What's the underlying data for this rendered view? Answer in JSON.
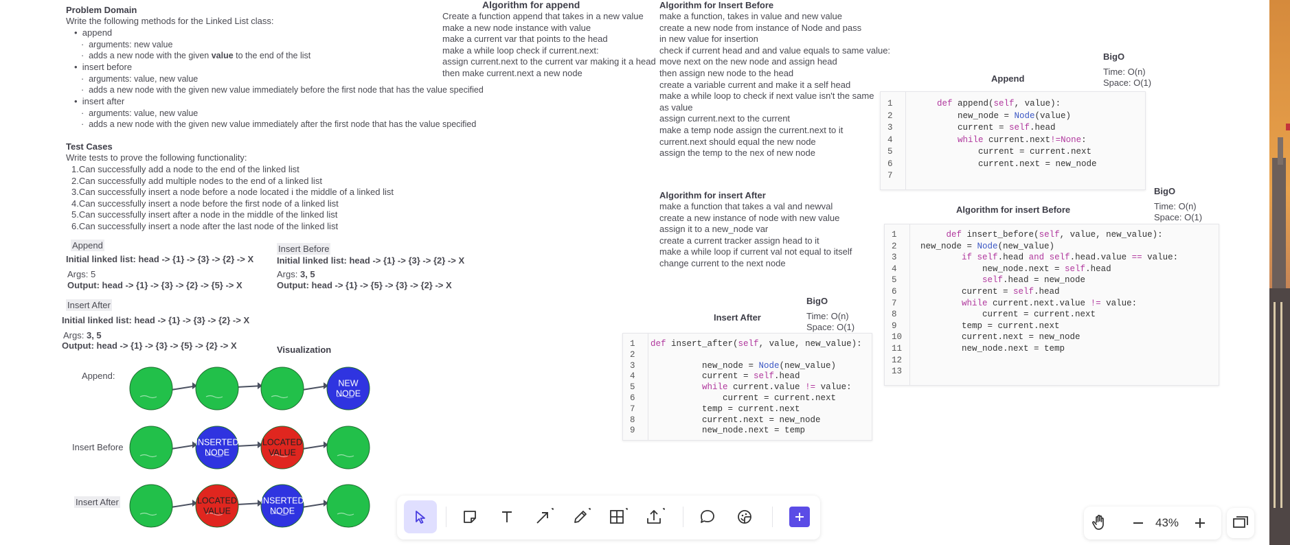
{
  "problem_domain": {
    "title": "Problem Domain",
    "intro": "Write the following methods for the Linked List class:",
    "methods": [
      {
        "name": "append",
        "args": "arguments: new value",
        "desc_pre": "adds a new node with the given ",
        "desc_bold": "value",
        "desc_post": " to the end of the list"
      },
      {
        "name": "insert before",
        "args": "arguments: value, new value",
        "desc_pre": "adds a new node with the given new value immediately before the first node that has the value specified",
        "desc_bold": "",
        "desc_post": ""
      },
      {
        "name": "insert after",
        "args": "arguments: value, new value",
        "desc_pre": "adds a new node with the given new value immediately after the first node that has the value specified",
        "desc_bold": "",
        "desc_post": ""
      }
    ]
  },
  "test_cases": {
    "title": "Test Cases",
    "intro": "Write tests to prove the following functionality:",
    "items": [
      "Can successfully add a node to the end of the linked list",
      "Can successfully add multiple nodes to the end of a linked list",
      "Can successfully insert a node before a node located i the middle of a linked list",
      "Can successfully insert a node before the first node of a linked list",
      "Can successfully insert after a node in the middle of the linked list",
      "Can successfully insert a node after the last node of the linked list"
    ],
    "numbers": [
      "1.",
      "2.",
      "3.",
      "4.",
      "5.",
      "6."
    ]
  },
  "examples": {
    "append": {
      "tag": "Append",
      "initial_label": "Initial linked list:",
      "initial": "head -> {1} -> {3} -> {2} -> X",
      "args_label": "Args:",
      "args": "5",
      "output_label": "Output:",
      "output": "head -> {1} -> {3} -> {2} -> {5} -> X"
    },
    "insert_before": {
      "tag": "Insert Before",
      "initial_label": "Initial linked list:",
      "initial": "head -> {1} -> {3} -> {2} -> X",
      "args_label": "Args:",
      "args": "3, 5",
      "output_label": "Output:",
      "output": "head -> {1} -> {5} -> {3} -> {2} -> X"
    },
    "insert_after": {
      "tag": "Insert After",
      "initial_label": "Initial linked list:",
      "initial": "head -> {1} -> {3} -> {2} -> X",
      "args_label": "Args:",
      "args": "3, 5",
      "output_label": "Output:",
      "output": "head -> {1} -> {3} -> {5} -> {2} -> X"
    }
  },
  "visualization": {
    "title": "Visualization",
    "rows": [
      {
        "label": "Append:",
        "nodes": [
          {
            "color": "green",
            "text": ""
          },
          {
            "color": "green",
            "text": ""
          },
          {
            "color": "green",
            "text": ""
          },
          {
            "color": "blue",
            "text": "NEW NODE"
          }
        ]
      },
      {
        "label": "Insert Before",
        "nodes": [
          {
            "color": "green",
            "text": ""
          },
          {
            "color": "blue",
            "text": "INSERTED NODE"
          },
          {
            "color": "red",
            "text": "LOCATED VALUE"
          },
          {
            "color": "green",
            "text": ""
          }
        ]
      },
      {
        "label": "Insert After",
        "nodes": [
          {
            "color": "green",
            "text": ""
          },
          {
            "color": "red",
            "text": "LOCATED VALUE"
          },
          {
            "color": "blue",
            "text": "INSERTED NODE"
          },
          {
            "color": "green",
            "text": ""
          }
        ]
      }
    ],
    "colors": {
      "green": "#22c04a",
      "blue": "#2f34e0",
      "red": "#e0261f"
    }
  },
  "algo_append": {
    "title": "Algorithm for append",
    "lines": [
      "Create a function append that takes in a new value",
      "make a new node instance with value",
      "make a current var that points to the head",
      "make a while loop check if current.next:",
      "assign current.next to the current var making it a head",
      "then make current.next a new node"
    ]
  },
  "algo_insert_before": {
    "title": "Algorithm for Insert Before",
    "lines": [
      "make a function, takes in value and new value",
      "create a new node from instance of Node and pass",
      "in new value for insertion",
      "check if current head and and value equals to same value:",
      "move next on the new node and assign head",
      "then assign new node to the head",
      "create a variable current and make it a self head",
      "make a while loop to check if next value isn't the same",
      "as value",
      "assign current.next to the current",
      "make a temp node assign the current.next to it",
      "current.next should equal the new node",
      "assign the temp to the nex of new node"
    ]
  },
  "algo_insert_after": {
    "title": "Algorithm for insert After",
    "lines": [
      "make a function that takes a val and newval",
      "create a new instance of node with new value",
      "assign it to a new_node var",
      "create a current tracker assign head to it",
      "make a while loop if current val not equal to itself",
      "change current to the next node"
    ]
  },
  "bigo_append": {
    "title": "BigO",
    "time": "Time: O(n)",
    "space": "Space: O(1)"
  },
  "bigo_insert_before": {
    "title": "BigO",
    "time": "Time: O(n)",
    "space": "Space: O(1)"
  },
  "bigo_insert_after": {
    "title": "BigO",
    "time": "Time: O(n)",
    "space": "Space: O(1)"
  },
  "code_append": {
    "caption": "Append",
    "line_numbers": [
      "1",
      "2",
      "3",
      "4",
      "5",
      "6",
      "7"
    ],
    "lines": [
      "    def append(self, value):",
      "        new_node = Node(value)",
      "        current = self.head",
      "        while current.next!=None:",
      "            current = current.next",
      "            current.next = new_node",
      ""
    ]
  },
  "code_insert_before": {
    "caption": "Algorithm for insert Before",
    "line_numbers": [
      "1",
      "2",
      "3",
      "4",
      "5",
      "6",
      "7",
      "8",
      "9",
      "10",
      "11",
      "12",
      "13"
    ],
    "lines": [
      "     def insert_before(self, value, new_value):",
      "new_node = Node(new_value)",
      "        if self.head and self.head.value == value:",
      "            new_node.next = self.head",
      "            self.head = new_node",
      "        current = self.head",
      "        while current.next.value != value:",
      "            current = current.next",
      "        temp = current.next",
      "        current.next = new_node",
      "        new_node.next = temp",
      "",
      ""
    ]
  },
  "code_insert_after": {
    "caption": "Insert After",
    "line_numbers": [
      "1",
      "2",
      "3",
      "4",
      "5",
      "6",
      "7",
      "8",
      "9"
    ],
    "lines": [
      "def insert_after(self, value, new_value):",
      "",
      "          new_node = Node(new_value)",
      "          current = self.head",
      "          while current.value != value:",
      "              current = current.next",
      "          temp = current.next",
      "          current.next = new_node",
      "          new_node.next = temp"
    ]
  },
  "toolbar": {
    "tools": [
      "select-tool",
      "sticky-note-tool",
      "text-tool",
      "line-tool",
      "pen-tool",
      "table-tool",
      "upload-tool",
      "comment-tool",
      "sticker-tool",
      "add-button"
    ]
  },
  "zoom": {
    "value": "43%"
  },
  "accent_color": "#5b4ce6"
}
